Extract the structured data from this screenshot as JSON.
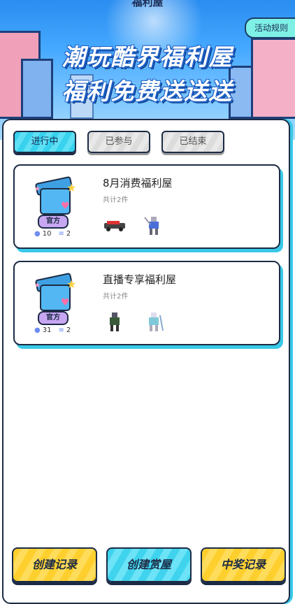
{
  "header": {
    "title": "福利屋",
    "rules_label": "活动规则",
    "slogan_line1": "潮玩酷界福利屋",
    "slogan_line2": "福利免费送送送"
  },
  "tabs": [
    {
      "label": "进行中",
      "active": true
    },
    {
      "label": "已参与",
      "active": false
    },
    {
      "label": "已结束",
      "active": false
    }
  ],
  "cards": [
    {
      "badge": "官方",
      "likes": "10",
      "items": "2",
      "title": "8月消费福利屋",
      "count": "共计2件",
      "prize_icons": [
        "toy-car-icon",
        "robot-figure-icon"
      ]
    },
    {
      "badge": "官方",
      "likes": "31",
      "items": "2",
      "title": "直播专享福利屋",
      "count": "共计2件",
      "prize_icons": [
        "robot-figure-icon",
        "robot-figure-icon"
      ]
    }
  ],
  "bottom_buttons": {
    "create_record": "创建记录",
    "create_house": "创建赏屋",
    "win_record": "中奖记录"
  },
  "colors": {
    "accent_cyan": "#39c8e8",
    "accent_yellow": "#ffcf2e",
    "outline": "#1c2b45"
  }
}
